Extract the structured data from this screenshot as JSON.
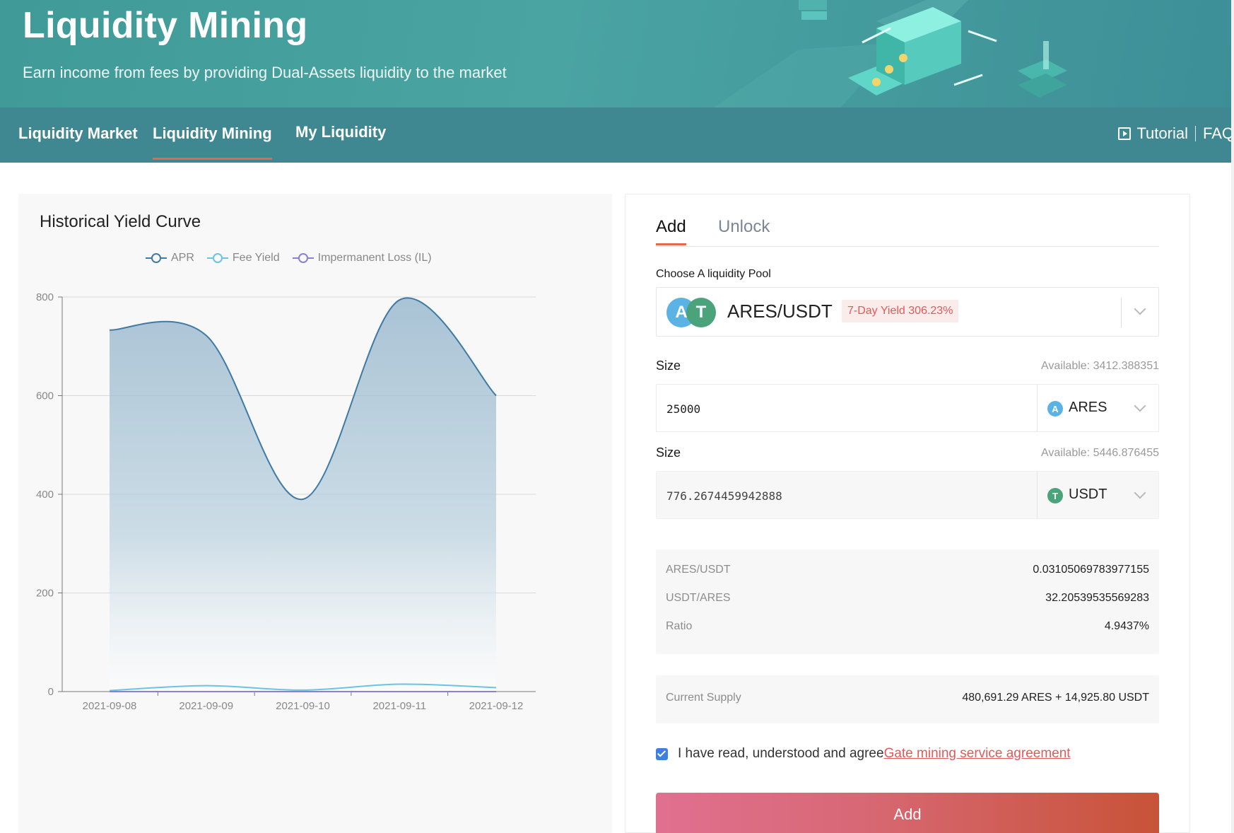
{
  "hero": {
    "title": "Liquidity Mining",
    "subtitle": "Earn income from fees by providing Dual-Assets liquidity to the market"
  },
  "nav": {
    "tabs": [
      {
        "label": "Liquidity Market",
        "active": false
      },
      {
        "label": "Liquidity Mining",
        "active": true
      },
      {
        "label": "My Liquidity",
        "active": false
      }
    ],
    "tutorial": "Tutorial",
    "faq": "FAQ"
  },
  "chart": {
    "title": "Historical Yield Curve",
    "legend": [
      "APR",
      "Fee Yield",
      "Impermanent Loss (IL)"
    ]
  },
  "chart_data": {
    "type": "line",
    "title": "Historical Yield Curve",
    "categories": [
      "2021-09-08",
      "2021-09-09",
      "2021-09-10",
      "2021-09-11",
      "2021-09-12"
    ],
    "ylim": [
      0,
      800
    ],
    "yticks": [
      0,
      200,
      400,
      600,
      800
    ],
    "grid": true,
    "legend_position": "top-center",
    "series": [
      {
        "name": "APR",
        "values": [
          733,
          722,
          390,
          794,
          600
        ],
        "color": "#3f7aa6",
        "area": true
      },
      {
        "name": "Fee Yield",
        "values": [
          2,
          12,
          3,
          15,
          8
        ],
        "color": "#69c4e6"
      },
      {
        "name": "Impermanent Loss (IL)",
        "values": [
          0,
          0,
          0,
          0,
          0
        ],
        "color": "#8b7fd6"
      }
    ]
  },
  "form": {
    "tabs": [
      {
        "label": "Add",
        "active": true
      },
      {
        "label": "Unlock",
        "active": false
      }
    ],
    "pool_label": "Choose A liquidity Pool",
    "pool": {
      "name": "ARES/USDT",
      "yield": "7-Day Yield 306.23%"
    },
    "size1": {
      "label": "Size",
      "available": "Available: 3412.388351",
      "value": "25000",
      "token": "ARES"
    },
    "size2": {
      "label": "Size",
      "available": "Available: 5446.876455",
      "value": "776.2674459942888",
      "token": "USDT"
    },
    "info": [
      {
        "key": "ARES/USDT",
        "value": "0.03105069783977155"
      },
      {
        "key": "USDT/ARES",
        "value": "32.20539535569283"
      },
      {
        "key": "Ratio",
        "value": "4.9437%"
      }
    ],
    "supply": {
      "key": "Current Supply",
      "value": "480,691.29 ARES + 14,925.80 USDT"
    },
    "agree_text": "I have read, understood and agree",
    "agree_link": "Gate mining service agreement",
    "submit": "Add"
  },
  "colors": {
    "hero_bg": "#4aa4a2",
    "nav_bg": "#3f8891",
    "accent": "#e6674f",
    "apr": "#3f7aa6",
    "fee": "#69c4e6",
    "il": "#8b7fd6"
  }
}
